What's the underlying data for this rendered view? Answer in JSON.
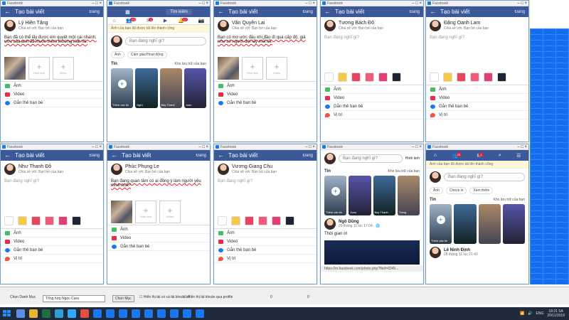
{
  "post_title": "Tạo bài viết",
  "post_button": "Đăng",
  "share_chip": "Chia sẻ với: Bạn bè của bạn",
  "placeholder": "Bạn đang nghĩ gì?",
  "add_photo": "Hình ảnh",
  "add_video": "Video",
  "opt_photo": "Ảnh",
  "opt_video": "Video",
  "opt_tag": "Gắn thẻ bạn bè",
  "opt_location": "Vị trí",
  "win_app": "Facebook",
  "windows": [
    {
      "user": "Lý Hiền Tăng",
      "text": "Bạn đã có thể lấy được ém quyết một cái nhanh, ước của anh đã muốn thêm thường mất rồi."
    },
    {
      "user": "Văn Quyền Lai",
      "text": "Bạn có mơ ước đâu khi đầu đi quá cấp độ, giả như có người đợi lấy mỗi tối."
    },
    {
      "user": "Tương Bách Đô",
      "text": ""
    },
    {
      "user": "Đặng Oanh Lam",
      "text": ""
    },
    {
      "user": "Như Thanh Đô",
      "text": ""
    },
    {
      "user": "Phúc Phụng Le",
      "text": "Bạn đang quan tâm có ai đồng ý làm người yêu mình hok?"
    },
    {
      "user": "Vương Giang Chu",
      "text": ""
    }
  ],
  "feed": {
    "search": "Tìm kiếm",
    "notice": "Ảnh của bạn đã được tải lên thành công",
    "chip_photo": "Ảnh",
    "chip_feel": "Cảm giác/Hoạt động",
    "chip_checkin": "Check in",
    "chip_more": "Xem thêm",
    "stories": "Tin",
    "archive": "Kho lưu trữ của bạn",
    "add_story": "Thêm vào tin",
    "story_names": [
      "Nghị",
      "Bay Thanh",
      "Joan",
      "Trang"
    ],
    "post_author": "Ngô Dũng",
    "post_time": "29 tháng 11 lúc 17:04 · 🌐",
    "post_text": "Thời gian ơi",
    "url": "https://m.facebook.com/photo.php?fbid=8345...",
    "post2_author": "Lê Ninh Định",
    "post2_time": "28 tháng 11 lúc 21:40",
    "badges": [
      "23",
      "1",
      "17"
    ]
  },
  "bottom": {
    "label": "Chọn Danh Mục",
    "dropdown": "Tổng hợp Ngọc Cara",
    "button": "Chọn Mục",
    "check1": "Hiển thị tài có cá tài khoản số",
    "check2": "Hiển thị tài khoản qua profile",
    "count_a": "0",
    "count_b": "0"
  },
  "tray": {
    "lang": "ENG",
    "time": "18:21 SA",
    "date": "20/11/2019"
  }
}
